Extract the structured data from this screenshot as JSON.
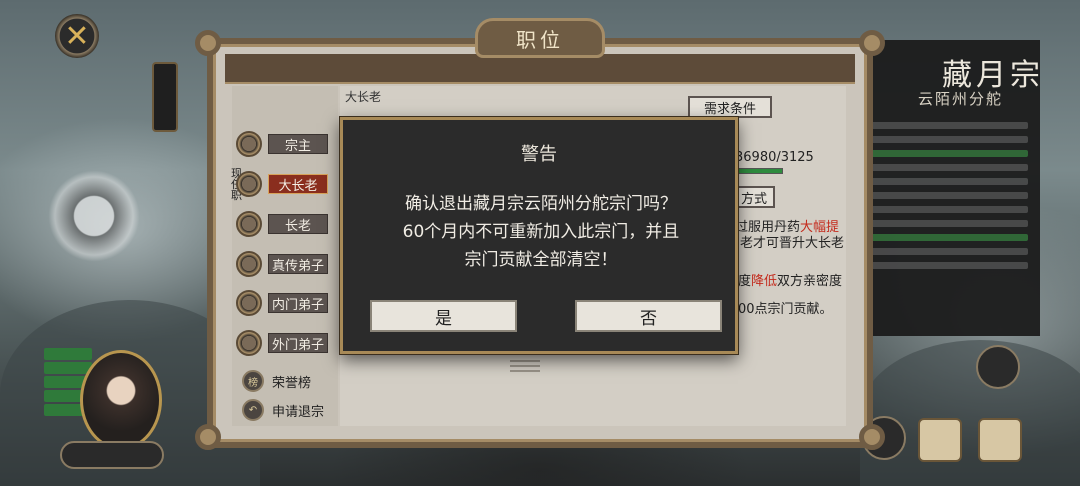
{
  "frame": {
    "title": "职位"
  },
  "positions": [
    {
      "label": "宗主",
      "active": false
    },
    {
      "label": "大长老",
      "active": true
    },
    {
      "label": "长老",
      "active": false
    },
    {
      "label": "真传弟子",
      "active": false
    },
    {
      "label": "内门弟子",
      "active": false
    },
    {
      "label": "外门弟子",
      "active": false
    }
  ],
  "current_tag": "现任职",
  "special": {
    "honor": {
      "icon": "榜",
      "label": "荣誉榜"
    },
    "quit": {
      "label": "申请退宗"
    }
  },
  "content": {
    "subtitle": "大长老",
    "requirement_button": "需求条件",
    "progress_text": "36980/3125",
    "way_button": "方式",
    "line1_pre": "过服用丹药",
    "line1_red": "大幅提",
    "line2": "老才可晋升大长老",
    "line3_pre": "度",
    "line3_red": "降低",
    "line3_post": "双方亲密度",
    "line4": "00点宗门贡献。"
  },
  "sect": {
    "title": "藏月宗",
    "subtitle": "云陌州分舵"
  },
  "modal": {
    "title": "警告",
    "message_line1": "确认退出藏月宗云陌州分舵宗门吗？",
    "message_line2": "60个月内不可重新加入此宗门，并且",
    "message_line3": "宗门贡献全部清空！",
    "yes_label": "是",
    "no_label": "否"
  },
  "colors": {
    "frame_wood": "#6f5c44",
    "active_position": "#8a2e1e",
    "modal_bg": "#2b2b2b",
    "modal_border": "#a88a57",
    "highlight_red": "#c42a1c",
    "progress_green": "#2e8b3e"
  }
}
